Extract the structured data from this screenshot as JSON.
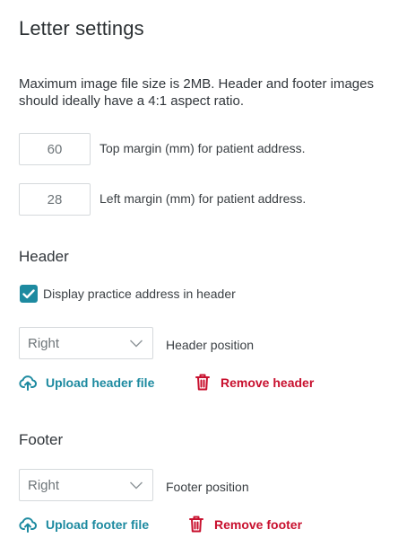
{
  "page": {
    "title": "Letter settings",
    "info_line1": "Maximum image file size is 2MB. Header and footer images",
    "info_line2": "should ideally have a 4:1 aspect ratio."
  },
  "margins": {
    "top": {
      "value": "60",
      "label": "Top margin (mm) for patient address."
    },
    "left": {
      "value": "28",
      "label": "Left margin (mm) for patient address."
    }
  },
  "header": {
    "heading": "Header",
    "display_address": {
      "checked": true,
      "label": "Display practice address in header"
    },
    "position": {
      "selected": "Right",
      "label": "Header position"
    },
    "upload_label": "Upload header file",
    "remove_label": "Remove header"
  },
  "footer": {
    "heading": "Footer",
    "position": {
      "selected": "Right",
      "label": "Footer position"
    },
    "upload_label": "Upload footer file",
    "remove_label": "Remove footer"
  },
  "colors": {
    "accent": "#1d8aa0",
    "danger": "#c8102e",
    "text": "#2b3033",
    "border": "#d5d9dc"
  },
  "icons": {
    "upload": "cloud-upload-icon",
    "remove": "trash-icon",
    "select": "chevron-down-icon",
    "check": "checkmark-icon"
  }
}
